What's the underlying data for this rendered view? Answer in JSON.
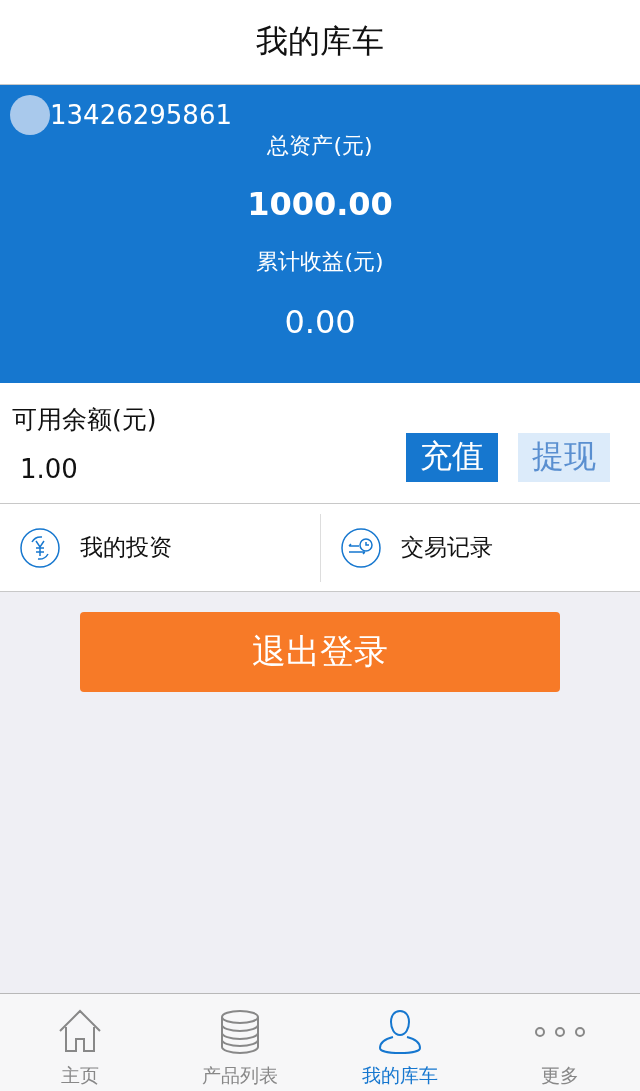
{
  "header": {
    "title": "我的库车"
  },
  "account": {
    "phone": "13426295861",
    "total_label": "总资产(元)",
    "total_value": "1000.00",
    "earnings_label": "累计收益(元)",
    "earnings_value": "0.00"
  },
  "balance": {
    "label": "可用余额(元)",
    "value": "1.00",
    "buttons": [
      {
        "label": "充值",
        "kind": "primary"
      },
      {
        "label": "提现",
        "kind": "secondary"
      }
    ]
  },
  "menu": [
    {
      "label": "我的投资",
      "kind": "invest"
    },
    {
      "label": "交易记录",
      "kind": "records"
    }
  ],
  "logout": {
    "label": "退出登录"
  },
  "tabs": [
    {
      "label": "主页",
      "kind": "home",
      "selected": false
    },
    {
      "label": "产品列表",
      "kind": "stack",
      "selected": false
    },
    {
      "label": "我的库车",
      "kind": "person",
      "selected": true
    },
    {
      "label": "更多",
      "kind": "more",
      "selected": false
    }
  ]
}
